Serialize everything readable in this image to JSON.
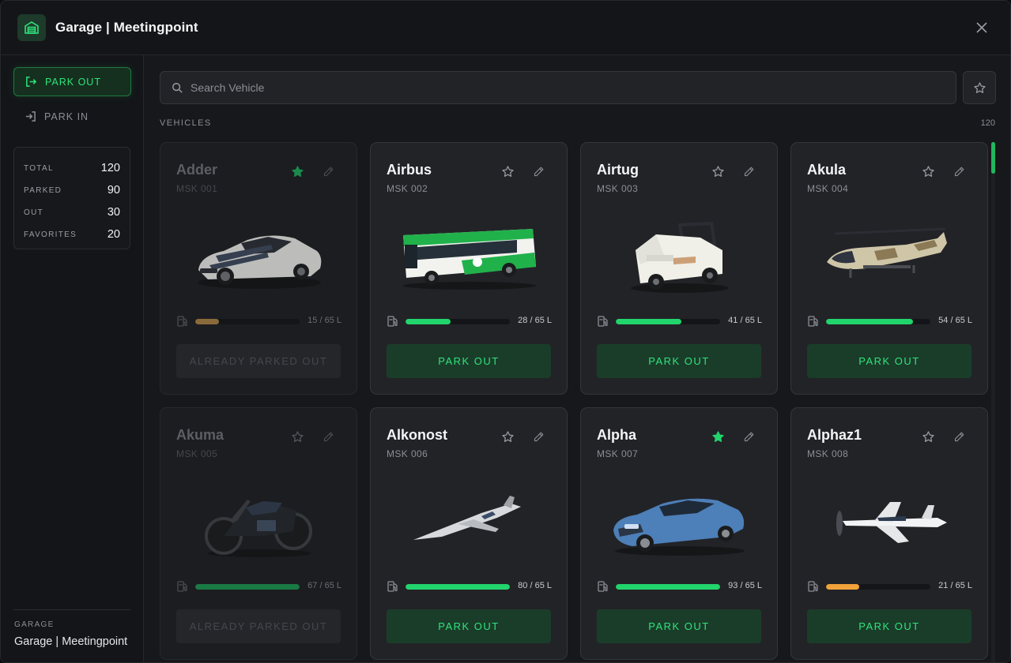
{
  "app": {
    "title": "Garage | Meetingpoint"
  },
  "sidebar": {
    "park_out_label": "PARK OUT",
    "park_in_label": "PARK IN",
    "stats": [
      {
        "label": "TOTAL",
        "value": "120"
      },
      {
        "label": "PARKED",
        "value": "90"
      },
      {
        "label": "OUT",
        "value": "30"
      },
      {
        "label": "FAVORITES",
        "value": "20"
      }
    ],
    "garage_label": "GARAGE",
    "garage_name": "Garage | Meetingpoint"
  },
  "search": {
    "placeholder": "Search Vehicle",
    "value": ""
  },
  "section": {
    "label": "VEHICLES",
    "count": "120"
  },
  "colors": {
    "accent": "#2fe37a",
    "accent_dark": "#1a3d2a",
    "fuel_high": "#22d46c",
    "fuel_low_orange": "#f2a23a",
    "fuel_low_brown": "#8a6a3a"
  },
  "vehicles": [
    {
      "name": "Adder",
      "plate": "MSK 001",
      "fuel": "15 / 65 L",
      "fuel_level": 0.23,
      "fuel_color": "#8a6a3a",
      "favorite": true,
      "parked_out": true,
      "action": "ALREADY PARKED OUT",
      "image": "supercar"
    },
    {
      "name": "Airbus",
      "plate": "MSK 002",
      "fuel": "28 / 65 L",
      "fuel_level": 0.43,
      "fuel_color": "#22d46c",
      "favorite": false,
      "parked_out": false,
      "action": "PARK OUT",
      "image": "bus"
    },
    {
      "name": "Airtug",
      "plate": "MSK 003",
      "fuel": "41 / 65 L",
      "fuel_level": 0.63,
      "fuel_color": "#22d46c",
      "favorite": false,
      "parked_out": false,
      "action": "PARK OUT",
      "image": "tug"
    },
    {
      "name": "Akula",
      "plate": "MSK 004",
      "fuel": "54 / 65 L",
      "fuel_level": 0.83,
      "fuel_color": "#22d46c",
      "favorite": false,
      "parked_out": false,
      "action": "PARK OUT",
      "image": "helicopter"
    },
    {
      "name": "Akuma",
      "plate": "MSK 005",
      "fuel": "67 / 65 L",
      "fuel_level": 1.0,
      "fuel_color": "#1a7a44",
      "favorite": false,
      "parked_out": true,
      "action": "ALREADY PARKED OUT",
      "image": "motorbike"
    },
    {
      "name": "Alkonost",
      "plate": "MSK 006",
      "fuel": "80 / 65 L",
      "fuel_level": 1.0,
      "fuel_color": "#22d46c",
      "favorite": false,
      "parked_out": false,
      "action": "PARK OUT",
      "image": "jet"
    },
    {
      "name": "Alpha",
      "plate": "MSK 007",
      "fuel": "93 / 65 L",
      "fuel_level": 1.0,
      "fuel_color": "#22d46c",
      "favorite": true,
      "parked_out": false,
      "action": "PARK OUT",
      "image": "coupe"
    },
    {
      "name": "Alphaz1",
      "plate": "MSK 008",
      "fuel": "21 / 65 L",
      "fuel_level": 0.32,
      "fuel_color": "#f2a23a",
      "favorite": false,
      "parked_out": false,
      "action": "PARK OUT",
      "image": "propplane"
    }
  ]
}
